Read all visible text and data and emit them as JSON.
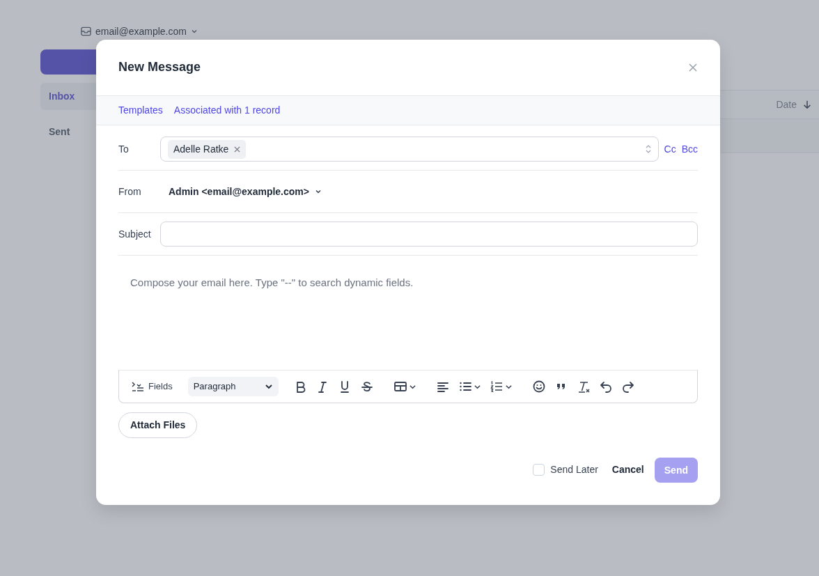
{
  "background": {
    "account": "email@example.com",
    "folders": [
      {
        "label": "Inbox",
        "selected": true
      },
      {
        "label": "Sent",
        "selected": false
      }
    ],
    "table": {
      "columns": [
        {
          "label": "Date",
          "sorted_descending": true
        }
      ]
    }
  },
  "dialog": {
    "title": "New Message",
    "links": [
      "Templates",
      "Associated with 1 record"
    ],
    "to": {
      "label": "To",
      "recipients": [
        "Adelle Ratke"
      ],
      "extra": [
        "Cc",
        "Bcc"
      ]
    },
    "from": {
      "label": "From",
      "value": "Admin <email@example.com>"
    },
    "subject": {
      "label": "Subject"
    },
    "body": {
      "placeholder": "Compose your email here. Type \"--\" to search dynamic fields."
    },
    "toolbar": {
      "fields": "Fields",
      "block_style": "Paragraph",
      "groups": [
        [
          {
            "kind": "bold"
          },
          {
            "kind": "italic"
          },
          {
            "kind": "underline"
          },
          {
            "kind": "strike"
          }
        ],
        [
          {
            "kind": "table",
            "dropdown": true
          }
        ],
        [
          {
            "kind": "align"
          },
          {
            "kind": "bullets",
            "dropdown": true
          },
          {
            "kind": "numbers",
            "dropdown": true
          }
        ],
        [
          {
            "kind": "emoji"
          },
          {
            "kind": "quote"
          },
          {
            "kind": "clear"
          },
          {
            "kind": "undo"
          },
          {
            "kind": "redo"
          }
        ]
      ]
    },
    "attach": "Attach Files",
    "send_later": {
      "label": "Send Later",
      "checked": false
    },
    "cancel": "Cancel",
    "send": {
      "label": "Send",
      "disabled": true
    }
  }
}
